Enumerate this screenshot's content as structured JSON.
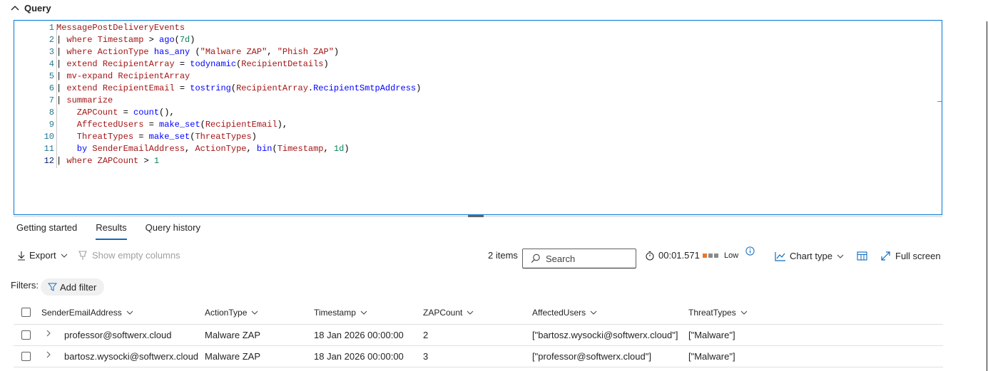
{
  "query_section": {
    "title": "Query"
  },
  "editor": {
    "lines": [
      {
        "n": "1",
        "tokens": [
          {
            "t": "MessagePostDeliveryEvents",
            "c": "id"
          }
        ]
      },
      {
        "n": "2",
        "tokens": [
          {
            "t": "| ",
            "c": "op"
          },
          {
            "t": "where ",
            "c": "kw"
          },
          {
            "t": "Timestamp ",
            "c": "id"
          },
          {
            "t": "> ",
            "c": "op"
          },
          {
            "t": "ago",
            "c": "fn"
          },
          {
            "t": "(",
            "c": "op"
          },
          {
            "t": "7d",
            "c": "num"
          },
          {
            "t": ")",
            "c": "op"
          }
        ]
      },
      {
        "n": "3",
        "tokens": [
          {
            "t": "| ",
            "c": "op"
          },
          {
            "t": "where ",
            "c": "kw"
          },
          {
            "t": "ActionType ",
            "c": "id"
          },
          {
            "t": "has_any ",
            "c": "fn"
          },
          {
            "t": "(",
            "c": "op"
          },
          {
            "t": "\"Malware ZAP\"",
            "c": "str"
          },
          {
            "t": ", ",
            "c": "op"
          },
          {
            "t": "\"Phish ZAP\"",
            "c": "str"
          },
          {
            "t": ")",
            "c": "op"
          }
        ]
      },
      {
        "n": "4",
        "tokens": [
          {
            "t": "| ",
            "c": "op"
          },
          {
            "t": "extend ",
            "c": "kw"
          },
          {
            "t": "RecipientArray ",
            "c": "id"
          },
          {
            "t": "= ",
            "c": "op"
          },
          {
            "t": "todynamic",
            "c": "fn"
          },
          {
            "t": "(",
            "c": "op"
          },
          {
            "t": "RecipientDetails",
            "c": "id"
          },
          {
            "t": ")",
            "c": "op"
          }
        ]
      },
      {
        "n": "5",
        "tokens": [
          {
            "t": "| ",
            "c": "op"
          },
          {
            "t": "mv-expand ",
            "c": "kw"
          },
          {
            "t": "RecipientArray",
            "c": "id"
          }
        ]
      },
      {
        "n": "6",
        "tokens": [
          {
            "t": "| ",
            "c": "op"
          },
          {
            "t": "extend ",
            "c": "kw"
          },
          {
            "t": "RecipientEmail ",
            "c": "id"
          },
          {
            "t": "= ",
            "c": "op"
          },
          {
            "t": "tostring",
            "c": "fn"
          },
          {
            "t": "(",
            "c": "op"
          },
          {
            "t": "RecipientArray",
            "c": "id"
          },
          {
            "t": ".",
            "c": "op"
          },
          {
            "t": "RecipientSmtpAddress",
            "c": "fn"
          },
          {
            "t": ")",
            "c": "op"
          }
        ]
      },
      {
        "n": "7",
        "tokens": [
          {
            "t": "| ",
            "c": "op"
          },
          {
            "t": "summarize",
            "c": "kw"
          }
        ]
      },
      {
        "n": "8",
        "tokens": [
          {
            "t": "    ZAPCount ",
            "c": "id"
          },
          {
            "t": "= ",
            "c": "op"
          },
          {
            "t": "count",
            "c": "fn"
          },
          {
            "t": "(),",
            "c": "op"
          }
        ]
      },
      {
        "n": "9",
        "tokens": [
          {
            "t": "    AffectedUsers ",
            "c": "id"
          },
          {
            "t": "= ",
            "c": "op"
          },
          {
            "t": "make_set",
            "c": "fn"
          },
          {
            "t": "(",
            "c": "op"
          },
          {
            "t": "RecipientEmail",
            "c": "id"
          },
          {
            "t": "),",
            "c": "op"
          }
        ]
      },
      {
        "n": "10",
        "tokens": [
          {
            "t": "    ThreatTypes ",
            "c": "id"
          },
          {
            "t": "= ",
            "c": "op"
          },
          {
            "t": "make_set",
            "c": "fn"
          },
          {
            "t": "(",
            "c": "op"
          },
          {
            "t": "ThreatTypes",
            "c": "id"
          },
          {
            "t": ")",
            "c": "op"
          }
        ]
      },
      {
        "n": "11",
        "tokens": [
          {
            "t": "    by ",
            "c": "fn"
          },
          {
            "t": "SenderEmailAddress",
            "c": "id"
          },
          {
            "t": ", ",
            "c": "op"
          },
          {
            "t": "ActionType",
            "c": "id"
          },
          {
            "t": ", ",
            "c": "op"
          },
          {
            "t": "bin",
            "c": "fn"
          },
          {
            "t": "(",
            "c": "op"
          },
          {
            "t": "Timestamp",
            "c": "id"
          },
          {
            "t": ", ",
            "c": "op"
          },
          {
            "t": "1d",
            "c": "num"
          },
          {
            "t": ")",
            "c": "op"
          }
        ]
      },
      {
        "n": "12",
        "tokens": [
          {
            "t": "| ",
            "c": "op"
          },
          {
            "t": "where ",
            "c": "kw"
          },
          {
            "t": "ZAPCount ",
            "c": "id"
          },
          {
            "t": "> ",
            "c": "op"
          },
          {
            "t": "1",
            "c": "num"
          }
        ]
      }
    ],
    "active_line": "12"
  },
  "tabs": [
    {
      "label": "Getting started",
      "selected": false
    },
    {
      "label": "Results",
      "selected": true
    },
    {
      "label": "Query history",
      "selected": false
    }
  ],
  "toolbar": {
    "export_label": "Export",
    "show_empty_label": "Show empty columns",
    "items_count": "2 items",
    "search_placeholder": "Search",
    "duration": "00:01.571",
    "perf_label": "Low",
    "chart_type_label": "Chart type",
    "full_screen_label": "Full screen"
  },
  "filters": {
    "label": "Filters:",
    "add_filter_label": "Add filter"
  },
  "table": {
    "columns": [
      "SenderEmailAddress",
      "ActionType",
      "Timestamp",
      "ZAPCount",
      "AffectedUsers",
      "ThreatTypes"
    ],
    "rows": [
      [
        "professor@softwerx.cloud",
        "Malware ZAP",
        "18 Jan 2026 00:00:00",
        "2",
        "[\"bartosz.wysocki@softwerx.cloud\"]",
        "[\"Malware\"]"
      ],
      [
        "bartosz.wysocki@softwerx.cloud",
        "Malware ZAP",
        "18 Jan 2026 00:00:00",
        "3",
        "[\"professor@softwerx.cloud\"]",
        "[\"Malware\"]"
      ]
    ]
  },
  "colors": {
    "accent": "#0f6cbd",
    "perf_high": "#e8772e",
    "perf_low": "#8a8a8a"
  }
}
